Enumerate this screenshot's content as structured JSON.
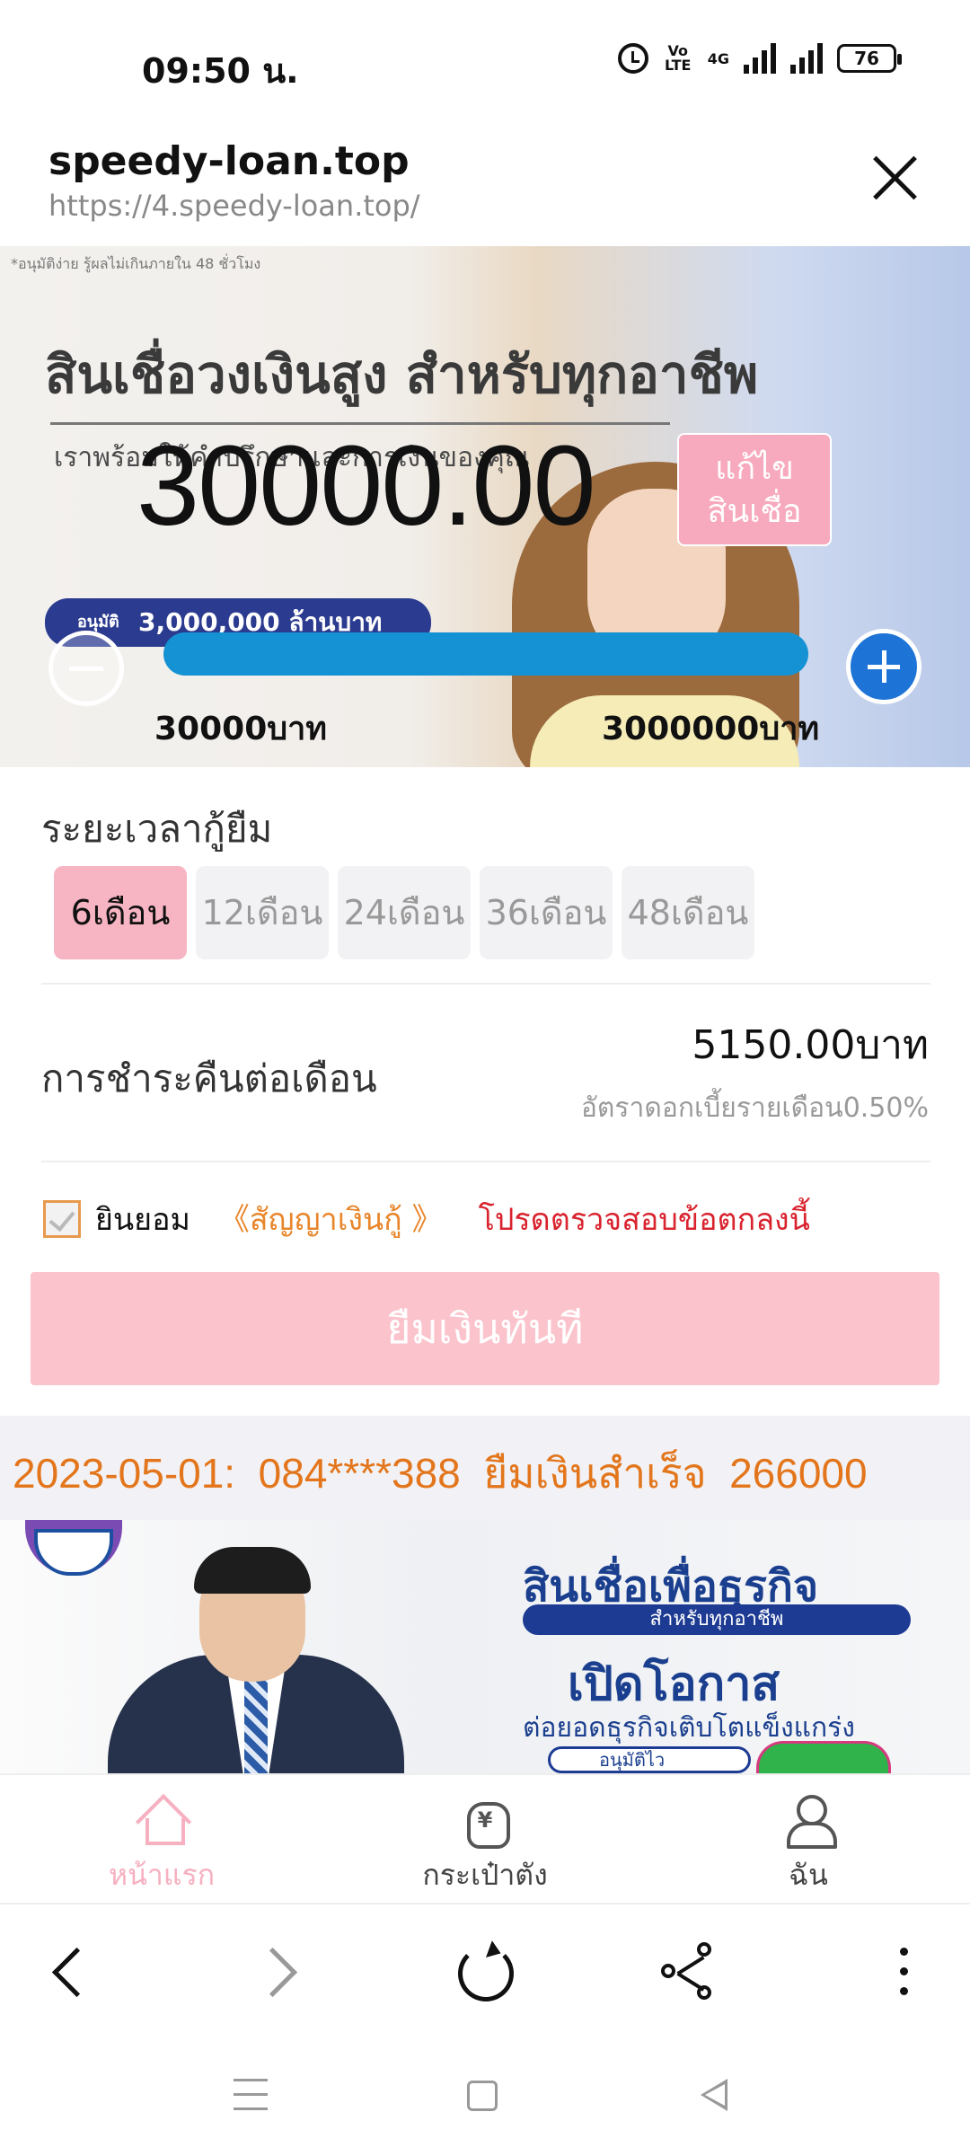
{
  "status_bar": {
    "time": "09:50 น.",
    "volte": "Vo LTE",
    "network": "4G",
    "battery": "76"
  },
  "browser": {
    "site_title": "speedy-loan.top",
    "url": "https://4.speedy-loan.top/"
  },
  "banner": {
    "fine_print": "*อนุมัติง่าย รู้ผลไม่เกินภายใน 48 ชั่วโมง",
    "headline": "สินเชื่อวงเงินสูง สำหรับทุกอาชีพ",
    "subline": "เราพร้อมให้คำปรึกษาและการเงินของคุณ",
    "badge_small": "อนุมัติ",
    "badge_text": "3,000,000 ล้านบาท"
  },
  "loan": {
    "amount": "30000.00",
    "edit_label_line1": "แก้ไข",
    "edit_label_line2": "สินเชื่อ",
    "min_label": "30000บาท",
    "max_label": "3000000บาท",
    "slider_fraction": 0.0
  },
  "term": {
    "title": "ระยะเวลากู้ยืม",
    "options": [
      "6เดือน",
      "12เดือน",
      "24เดือน",
      "36เดือน",
      "48เดือน"
    ],
    "selected": "6เดือน"
  },
  "repayment": {
    "label": "การชำระคืนต่อเดือน",
    "value": "5150.00บาท",
    "rate": "อัตราดอกเบี้ยรายเดือน0.50%"
  },
  "agreement": {
    "checked": true,
    "agree_text": "ยินยอม",
    "contract_link": "《สัญญาเงินกู้ 》",
    "note": "โปรดตรวจสอบข้อตกลงนี้"
  },
  "borrow_button": "ยืมเงินทันที",
  "ticker": {
    "date": "2023-05-01:",
    "phone": "084****388",
    "status": "ยืมเงินสำเร็จ",
    "amount": "266000"
  },
  "banner2": {
    "title": "สินเชื่อเพื่อธุรกิจ",
    "pill": "สำหรับทุกอาชีพ",
    "title2": "เปิดโอกาส",
    "subtitle": "ต่อยอดธุรกิจเติบโตแข็งแกร่ง",
    "pill2": "อนุมัติไว"
  },
  "tabbar": {
    "home": "หน้าแรก",
    "wallet": "กระเป๋าตัง",
    "me": "ฉัน",
    "active_color": "#f6b0c0"
  },
  "colors": {
    "accent_pink": "#f7b4c2",
    "slider_blue": "#1592d4",
    "ticker_orange": "#e3761c",
    "warning_red": "#d9232e"
  }
}
